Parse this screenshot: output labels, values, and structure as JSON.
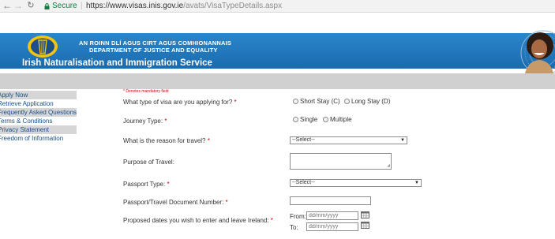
{
  "browser": {
    "secure_label": "Secure",
    "separator": "|",
    "url_host": "https://www.visas.inis.gov.ie",
    "url_path": "/avats/VisaTypeDetails.aspx"
  },
  "header": {
    "dept_irish": "AN ROINN DLÍ AGUS CIRT AGUS COMHIONANNAIS",
    "dept_english": "DEPARTMENT OF JUSTICE AND EQUALITY",
    "service_title": "Irish Naturalisation and Immigration Service",
    "band_color": "#1d71b3"
  },
  "sidebar": {
    "items": [
      {
        "label": "Apply Now",
        "shaded": true
      },
      {
        "label": "Retrieve Application",
        "shaded": false
      },
      {
        "label": "Frequently Asked Questions",
        "shaded": true
      },
      {
        "label": "Terms & Conditions",
        "shaded": false
      },
      {
        "label": "Privacy Statement",
        "shaded": true
      },
      {
        "label": "Freedom of Information",
        "shaded": false
      }
    ]
  },
  "form": {
    "mandatory_note": "* Denotes mandatory field",
    "visa_type": {
      "label": "What type of visa are you applying for?",
      "required_mark": "*",
      "options": [
        "Short Stay (C)",
        "Long Stay (D)"
      ]
    },
    "journey_type": {
      "label": "Journey Type:",
      "required_mark": "*",
      "options": [
        "Single",
        "Multiple"
      ]
    },
    "travel_reason": {
      "label": "What is the reason for travel?",
      "required_mark": "*",
      "selected": "--Select--"
    },
    "purpose": {
      "label": "Purpose of Travel:"
    },
    "passport_type": {
      "label": "Passport Type:",
      "required_mark": "*",
      "selected": "--Select--"
    },
    "passport_number": {
      "label": "Passport/Travel Document Number:",
      "required_mark": "*"
    },
    "dates": {
      "label": "Proposed dates you wish to enter and leave Ireland:",
      "required_mark": "*",
      "from_label": "From:",
      "to_label": "To:",
      "placeholder": "dd/mm/yyyy"
    }
  }
}
